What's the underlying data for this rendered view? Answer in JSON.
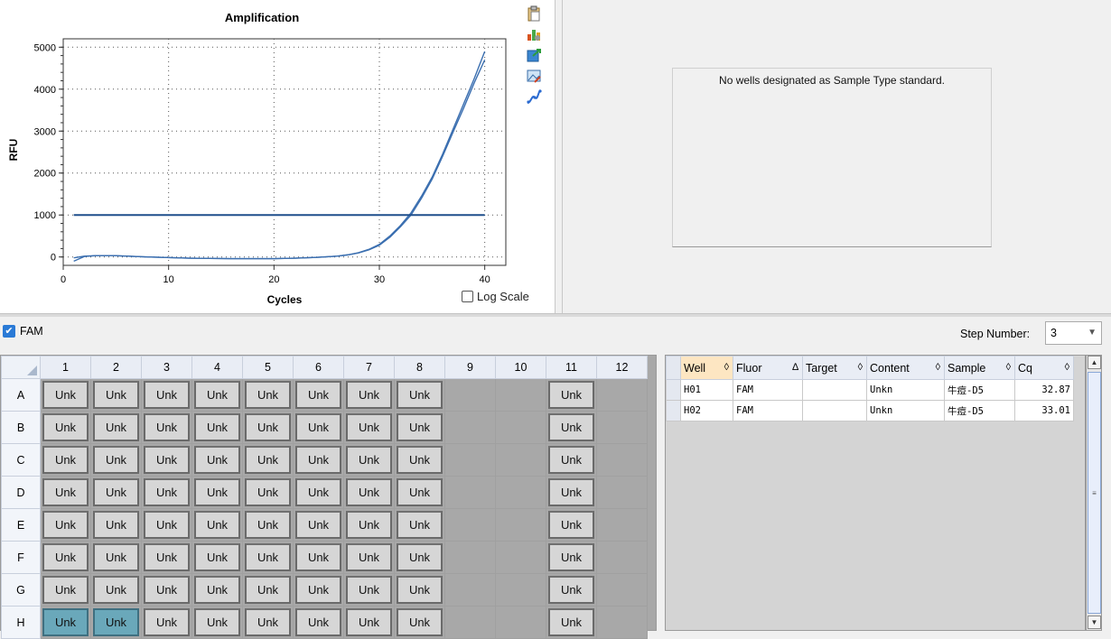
{
  "chart": {
    "title": "Amplification",
    "xlabel": "Cycles",
    "ylabel": "RFU",
    "x_ticks": [
      "0",
      "10",
      "20",
      "30",
      "40"
    ],
    "y_ticks": [
      "0",
      "1000",
      "2000",
      "3000",
      "4000",
      "5000"
    ],
    "log_scale_label": "Log Scale",
    "log_scale_checked": false
  },
  "chart_data": {
    "type": "line",
    "title": "Amplification",
    "xlabel": "Cycles",
    "ylabel": "RFU",
    "xlim": [
      0,
      42
    ],
    "ylim": [
      -200,
      5200
    ],
    "grid": true,
    "x_tick_values": [
      0,
      10,
      20,
      30,
      40
    ],
    "y_tick_values": [
      0,
      1000,
      2000,
      3000,
      4000,
      5000
    ],
    "threshold": 1000,
    "threshold_color": "#1f4f8c",
    "curve_color": "#3b6fb0",
    "series": [
      {
        "x": [
          1,
          2,
          3,
          5,
          8,
          12,
          16,
          20,
          22,
          24,
          26,
          27,
          28,
          29,
          30,
          31,
          32,
          33,
          34,
          35,
          36,
          37,
          38,
          39,
          40
        ],
        "values": [
          -100,
          10,
          30,
          30,
          0,
          -30,
          -40,
          -40,
          -30,
          -10,
          20,
          50,
          100,
          180,
          300,
          500,
          750,
          1050,
          1450,
          1900,
          2450,
          3050,
          3650,
          4250,
          4900
        ]
      },
      {
        "x": [
          1,
          2,
          3,
          5,
          8,
          12,
          16,
          20,
          22,
          24,
          26,
          27,
          28,
          29,
          30,
          31,
          32,
          33,
          34,
          35,
          36,
          37,
          38,
          39,
          40
        ],
        "values": [
          -20,
          20,
          30,
          30,
          0,
          -30,
          -40,
          -40,
          -30,
          -10,
          20,
          50,
          95,
          170,
          280,
          470,
          720,
          1000,
          1400,
          1850,
          2400,
          2980,
          3550,
          4150,
          4700
        ]
      }
    ]
  },
  "toolbar_icons": [
    "clipboard-icon",
    "chart-settings-icon",
    "export-icon",
    "image-icon",
    "curve-fit-icon"
  ],
  "standard_curve": {
    "message": "No wells designated as Sample Type standard."
  },
  "fluor": {
    "label": "FAM",
    "checked": true
  },
  "step": {
    "label": "Step Number:",
    "value": "3"
  },
  "plate": {
    "columns": [
      "1",
      "2",
      "3",
      "4",
      "5",
      "6",
      "7",
      "8",
      "9",
      "10",
      "11",
      "12"
    ],
    "rows": [
      "A",
      "B",
      "C",
      "D",
      "E",
      "F",
      "G",
      "H"
    ],
    "well_label": "Unk",
    "filled_columns": [
      1,
      2,
      3,
      4,
      5,
      6,
      7,
      8,
      11
    ],
    "selected_wells": [
      "H1",
      "H2"
    ]
  },
  "results": {
    "headers": [
      "Well",
      "Fluor",
      "Target",
      "Content",
      "Sample",
      "Cq"
    ],
    "sort_glyphs": [
      "◊",
      "∆",
      "◊",
      "◊",
      "◊",
      "◊"
    ],
    "rows": [
      [
        "H01",
        "FAM",
        "",
        "Unkn",
        "牛痘-D5",
        "32.87"
      ],
      [
        "H02",
        "FAM",
        "",
        "Unkn",
        "牛痘-D5",
        "33.01"
      ]
    ]
  },
  "colors": {
    "selected_well": "#6aa8ba",
    "well": "#d6d6d6",
    "sorted_header": "#fde6c2",
    "checkbox_accent": "#2a7ad6"
  }
}
